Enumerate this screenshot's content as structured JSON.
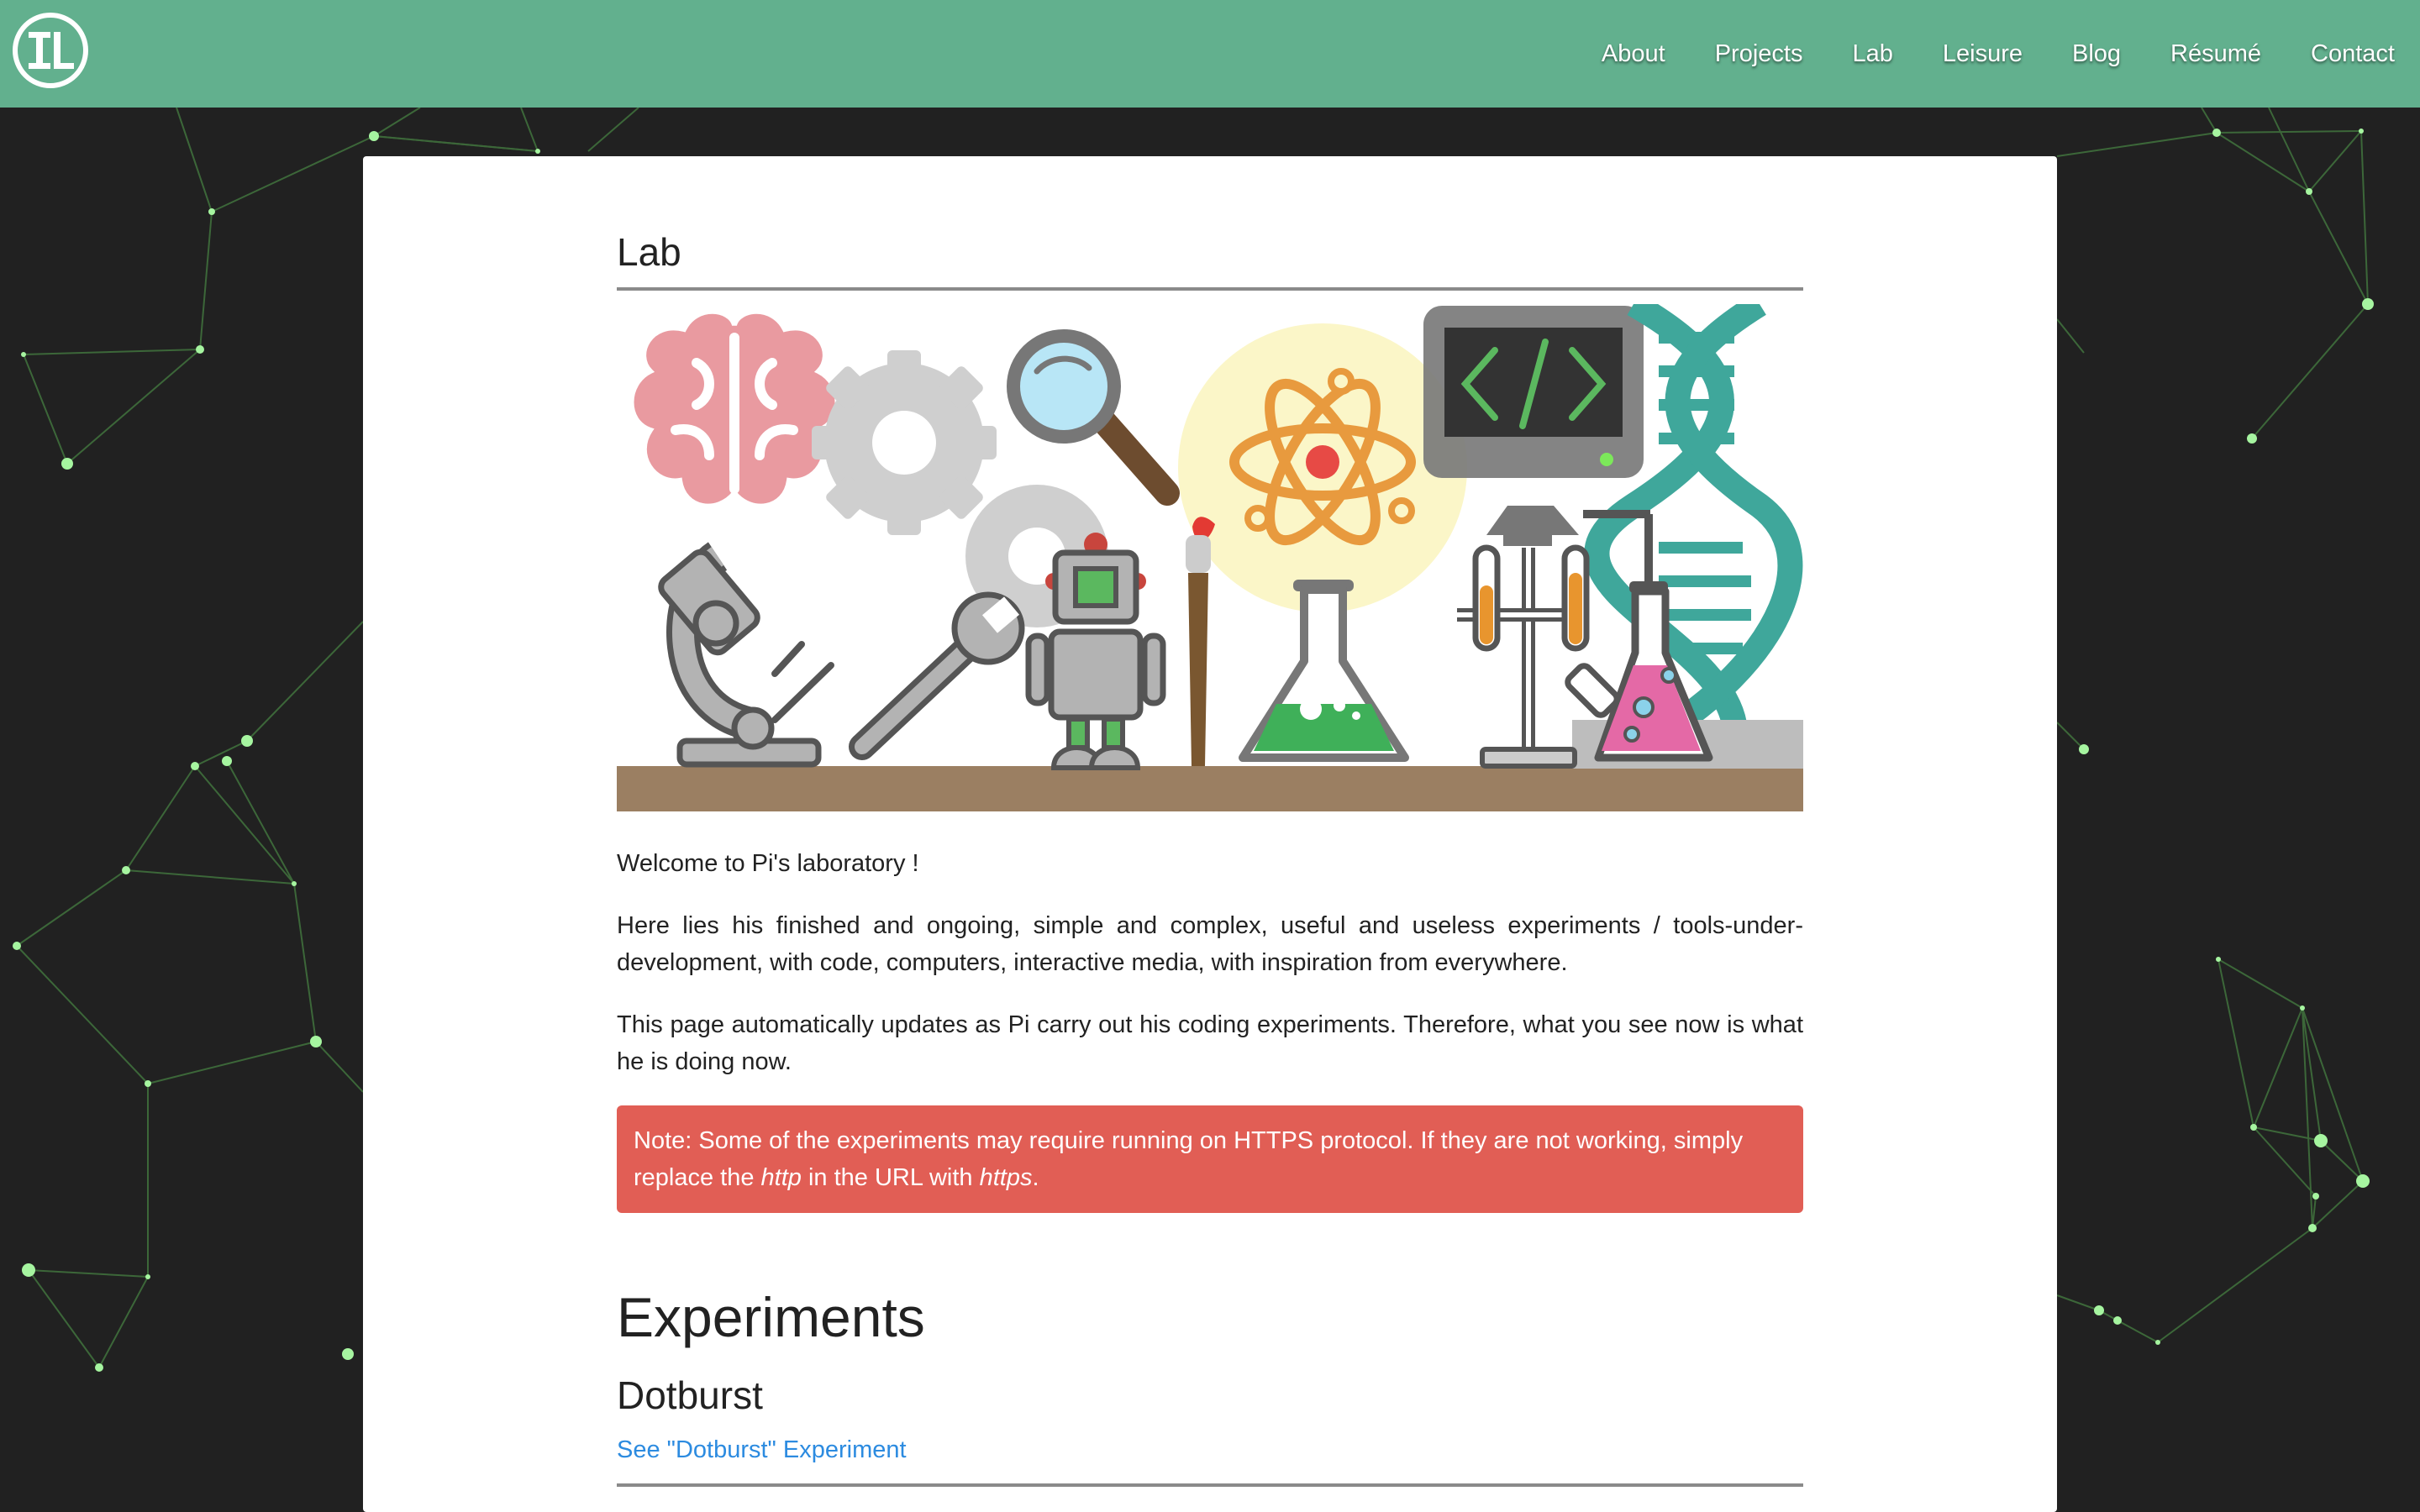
{
  "header": {
    "logo_text": "IL",
    "nav": [
      "About",
      "Projects",
      "Lab",
      "Leisure",
      "Blog",
      "Résumé",
      "Contact"
    ]
  },
  "main": {
    "title": "Lab",
    "intro": "Welcome to Pi's laboratory !",
    "paragraph_1": "Here lies his finished and ongoing, simple and complex, useful and useless experiments / tools-under-development, with code, computers, interactive media, with inspiration from everywhere.",
    "paragraph_2": "This page automatically updates as Pi carry out his coding experiments. Therefore, what you see now is what he is doing now.",
    "note": {
      "prefix": "Note: Some of the experiments may require running on HTTPS protocol. If they are not working, simply replace the ",
      "http": "http",
      "middle": " in the URL with ",
      "https": "https",
      "suffix": "."
    },
    "section_title": "Experiments",
    "experiments": [
      {
        "title": "Dotburst",
        "link_label": "See \"Dotburst\" Experiment"
      }
    ]
  },
  "colors": {
    "header_bg": "#62b08e",
    "page_bg": "#212121",
    "alert_bg": "#e15e55",
    "link": "#2c8be0",
    "network_node": "#a6f5a0",
    "network_line": "#3f6f3c"
  },
  "icons": [
    "logo-icon",
    "brain-icon",
    "gear-icon",
    "magnifier-icon",
    "atom-icon",
    "computer-icon",
    "dna-icon",
    "microscope-icon",
    "wrench-icon",
    "robot-icon",
    "paintbrush-icon",
    "flask-icon",
    "test-tube-rack-icon"
  ]
}
